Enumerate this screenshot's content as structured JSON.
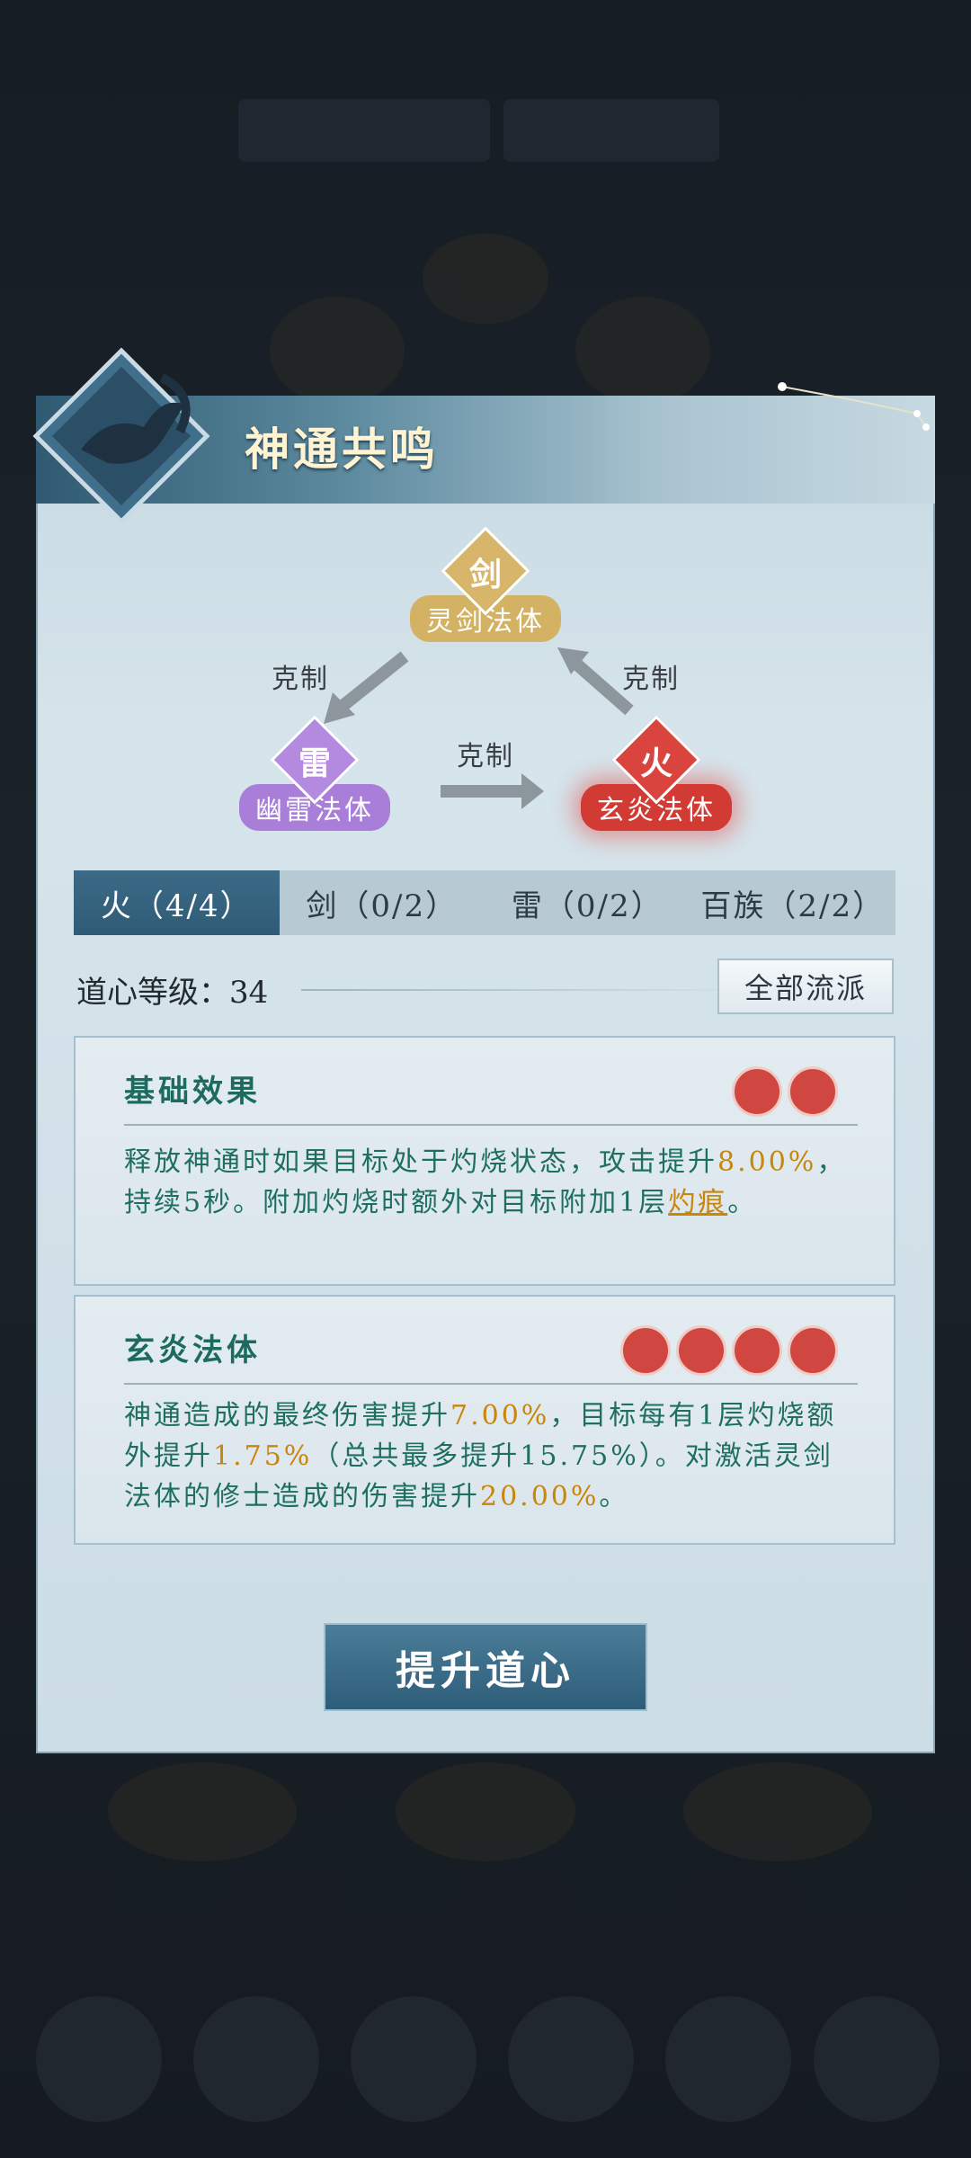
{
  "panel": {
    "title": "神通共鸣"
  },
  "diagram": {
    "nodes": [
      {
        "glyph": "剑",
        "name": "灵剑法体",
        "color": "#d4b264"
      },
      {
        "glyph": "雷",
        "name": "幽雷法体",
        "color": "#a97ed9"
      },
      {
        "glyph": "火",
        "name": "玄炎法体",
        "color": "#d23a34"
      }
    ],
    "relation_label": "克制"
  },
  "tabs": [
    {
      "label": "火（4/4）",
      "active": true
    },
    {
      "label": "剑（0/2）",
      "active": false
    },
    {
      "label": "雷（0/2）",
      "active": false
    },
    {
      "label": "百族（2/2）",
      "active": false
    }
  ],
  "level": {
    "label": "道心等级：",
    "value": "34"
  },
  "all_button": "全部流派",
  "cards": [
    {
      "title": "基础效果",
      "flames": 2,
      "text_parts": [
        "释放神通时如果目标处于灼烧状态，攻击提升",
        "8.00%",
        "，持续5秒。附加灼烧时额外对目标附加1层",
        "灼痕",
        "。"
      ]
    },
    {
      "title": "玄炎法体",
      "flames": 4,
      "text_parts": [
        "神通造成的最终伤害提升",
        "7.00%",
        "，目标每有1层灼烧额外提升",
        "1.75%",
        "（总共最多提升15.75%）。对激活灵剑法体的修士造成的伤害提升",
        "20.00%",
        "。"
      ]
    }
  ],
  "upgrade_button": "提升道心",
  "colors": {
    "accent": "#2f5b76",
    "highlight": "#c8860b",
    "text_green": "#1e6f60"
  }
}
